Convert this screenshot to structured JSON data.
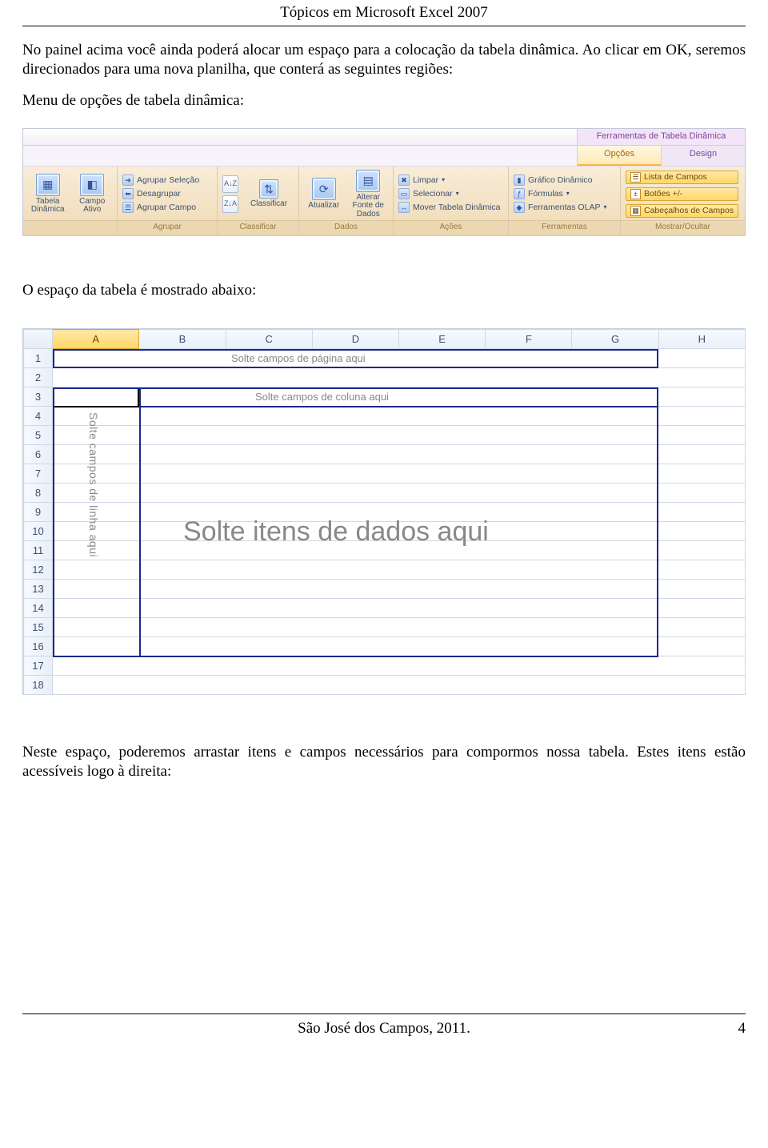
{
  "header": {
    "title": "Tópicos em Microsoft Excel 2007"
  },
  "text": {
    "para1": "No painel acima você ainda poderá alocar um espaço para a colocação da tabela dinâmica. Ao clicar em OK, seremos direcionados para uma nova planilha, que conterá as seguintes regiões:",
    "para2": "Menu de opções de tabela dinâmica:",
    "para3": "O espaço da tabela é mostrado abaixo:",
    "para4": "Neste espaço, poderemos arrastar itens e campos necessários para compormos nossa tabela. Estes itens estão acessíveis logo à direita:"
  },
  "ribbon": {
    "context_title": "Ferramentas de Tabela Dinâmica",
    "tabs": {
      "opcoes": "Opções",
      "design": "Design"
    },
    "groups": {
      "first": {
        "btn1": "Tabela Dinâmica",
        "btn2": "Campo Ativo"
      },
      "agrupar": {
        "label": "Agrupar",
        "items": {
          "a": "Agrupar Seleção",
          "b": "Desagrupar",
          "c": "Agrupar Campo"
        }
      },
      "classificar": {
        "label": "Classificar",
        "sort_az": "A↓Z",
        "sort_za": "Z↓A",
        "btn": "Classificar"
      },
      "dados": {
        "label": "Dados",
        "btn1": "Atualizar",
        "btn2": "Alterar Fonte de Dados"
      },
      "acoes": {
        "label": "Ações",
        "items": {
          "a": "Limpar",
          "b": "Selecionar",
          "c": "Mover Tabela Dinâmica"
        }
      },
      "ferramentas": {
        "label": "Ferramentas",
        "items": {
          "a": "Gráfico Dinâmico",
          "b": "Fórmulas",
          "c": "Ferramentas OLAP"
        }
      },
      "mostrar": {
        "label": "Mostrar/Ocultar",
        "items": {
          "a": "Lista de Campos",
          "b": "Botões +/-",
          "c": "Cabeçalhos de Campos"
        }
      }
    }
  },
  "sheet": {
    "cols": [
      "A",
      "B",
      "C",
      "D",
      "E",
      "F",
      "G",
      "H"
    ],
    "rows": [
      "1",
      "2",
      "3",
      "4",
      "5",
      "6",
      "7",
      "8",
      "9",
      "10",
      "11",
      "12",
      "13",
      "14",
      "15",
      "16",
      "17",
      "18"
    ],
    "page_fields_hint": "Solte campos de página aqui",
    "col_fields_hint": "Solte campos de coluna aqui",
    "row_fields_hint": "Solte campos de linha aqui",
    "data_items_hint": "Solte itens de dados aqui"
  },
  "footer": {
    "center": "São José dos Campos, 2011.",
    "pagenum": "4"
  }
}
